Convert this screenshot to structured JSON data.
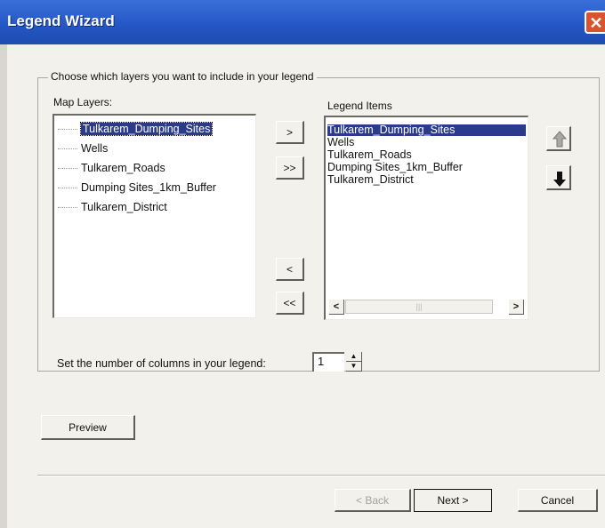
{
  "window": {
    "title": "Legend Wizard",
    "close_glyph": "✕"
  },
  "group": {
    "label": "Choose which layers you want to include in your legend"
  },
  "map_layers": {
    "label": "Map Layers:",
    "items": [
      "Tulkarem_Dumping_Sites",
      "Wells",
      "Tulkarem_Roads",
      "Dumping Sites_1km_Buffer",
      "Tulkarem_District"
    ],
    "selected_index": 0
  },
  "transfer_buttons": {
    "add": ">",
    "add_all": ">>",
    "remove": "<",
    "remove_all": "<<"
  },
  "legend_items": {
    "label": "Legend Items",
    "items": [
      "Tulkarem_Dumping_Sites",
      "Wells",
      "Tulkarem_Roads",
      "Dumping Sites_1km_Buffer",
      "Tulkarem_District"
    ],
    "selected_index": 0,
    "scroll_left": "<",
    "scroll_right": ">"
  },
  "order_icons": {
    "up": "arrow-up-icon",
    "down": "arrow-down-icon"
  },
  "columns": {
    "label": "Set the number of columns in your legend:",
    "value": "1"
  },
  "buttons": {
    "preview": "Preview",
    "back": "< Back",
    "next": "Next >",
    "cancel": "Cancel"
  },
  "colors": {
    "titlebar": "#2356c4",
    "selection": "#2b3a8c",
    "close": "#d9542e"
  }
}
